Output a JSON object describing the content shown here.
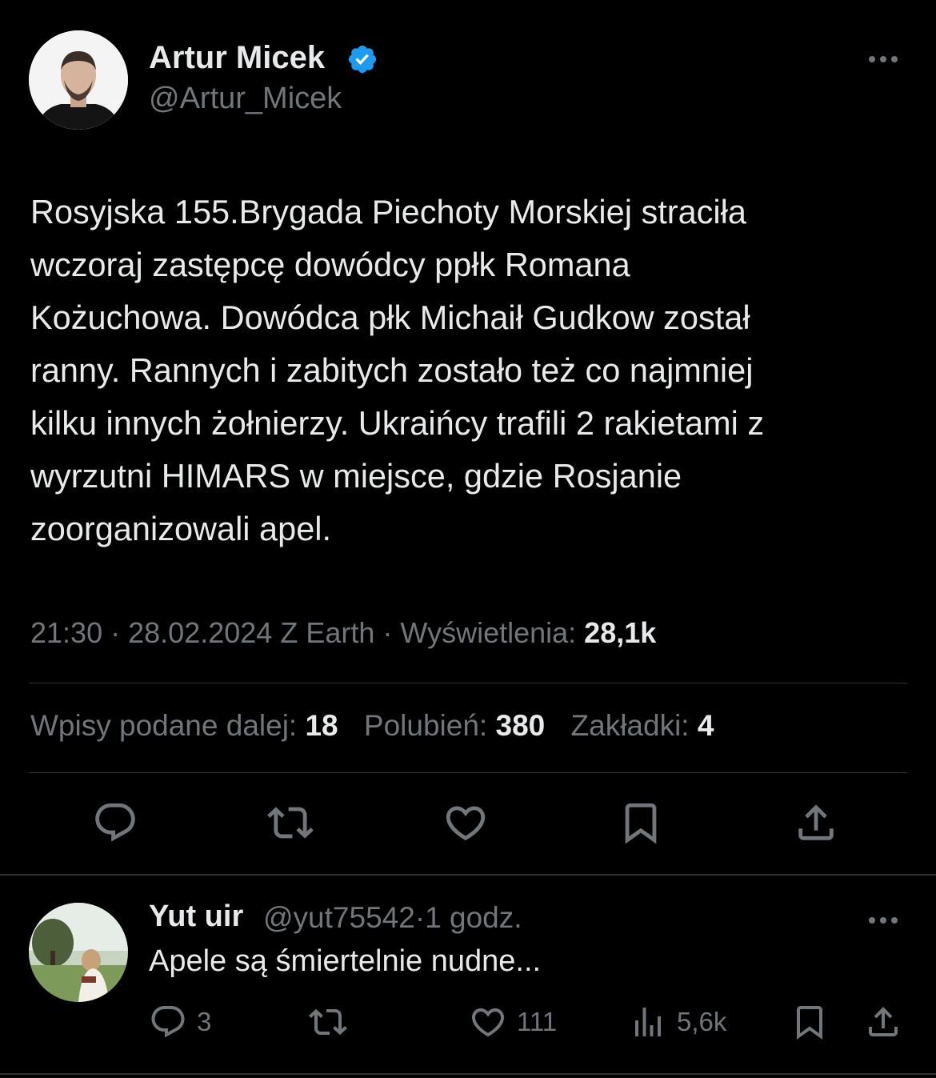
{
  "colors": {
    "background": "#000000",
    "text_primary": "#e7e9ea",
    "text_secondary": "#71767b",
    "divider": "#2f3336",
    "verified_badge": "#1d9bf0"
  },
  "tweet": {
    "author_name": "Artur Micek",
    "author_handle": "@Artur_Micek",
    "verified_icon": "verified-badge-icon",
    "more_icon": "more-options-icon",
    "text": "Rosyjska 155.Brygada Piechoty Morskiej straciła\nwczoraj zastępcę dowódcy ppłk Romana\nKożuchowa. Dowódca płk Michaił Gudkow został\nranny. Rannych i zabitych zostało też co najmniej\nkilku innych żołnierzy. Ukraińcy trafili 2 rakietami z\nwyrzutni HIMARS w miejsce, gdzie Rosjanie\nzoorganizowali apel.",
    "time": "21:30",
    "separator": "·",
    "date": "28.02.2024",
    "source": "Z Earth",
    "views_label": "Wyświetlenia:",
    "views_count": "28,1k",
    "reposts_label": "Wpisy podane dalej:",
    "reposts_count": "18",
    "likes_label": "Polubień:",
    "likes_count": "380",
    "bookmarks_label": "Zakładki:",
    "bookmarks_count": "4",
    "actions": {
      "reply": "reply-icon",
      "repost": "repost-icon",
      "like": "heart-icon",
      "bookmark": "bookmark-icon",
      "share": "share-icon"
    }
  },
  "reply": {
    "author_name": "Yut uir",
    "author_handle": "@yut75542",
    "separator": "·",
    "time": "1 godz.",
    "text": "Apele są śmiertelnie nudne...",
    "reply_count": "3",
    "repost_count": "",
    "like_count": "111",
    "views_count": "5,6k",
    "icons": {
      "reply": "reply-icon",
      "repost": "repost-icon",
      "like": "heart-icon",
      "views": "analytics-icon",
      "bookmark": "bookmark-icon",
      "share": "share-icon"
    }
  }
}
